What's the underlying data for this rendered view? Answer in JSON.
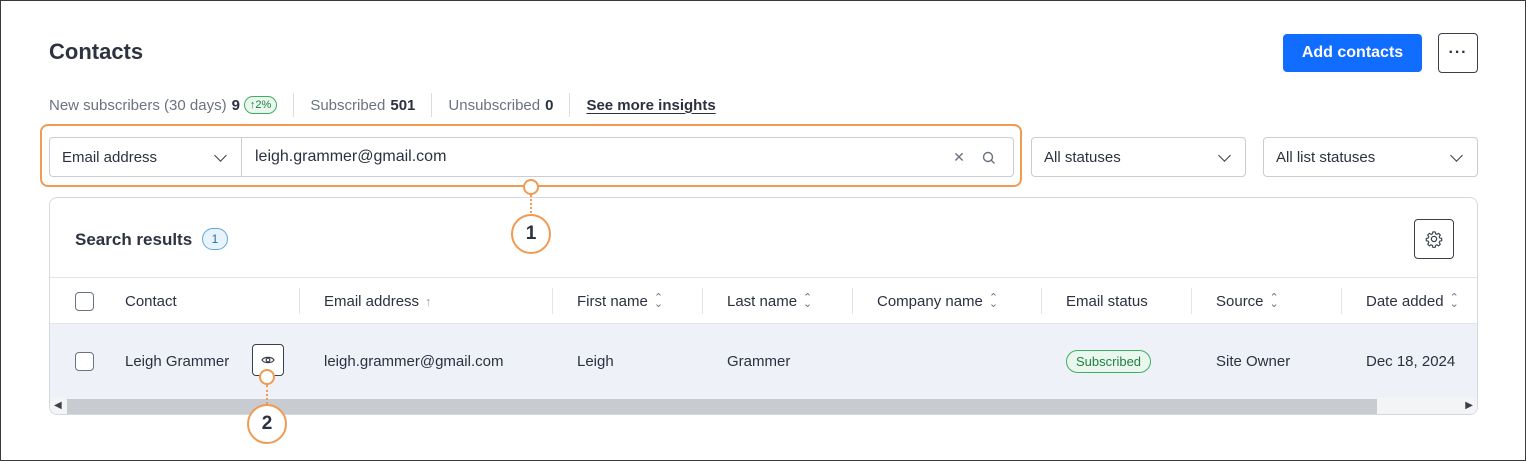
{
  "header": {
    "title": "Contacts",
    "add_button": "Add contacts",
    "more_button": "···"
  },
  "stats": {
    "new_subscribers_label": "New subscribers (30 days)",
    "new_subscribers_value": "9",
    "new_subscribers_trend": "↑2%",
    "subscribed_label": "Subscribed",
    "subscribed_value": "501",
    "unsubscribed_label": "Unsubscribed",
    "unsubscribed_value": "0",
    "insights_link": "See more insights"
  },
  "filters": {
    "search_type": "Email address",
    "search_value": "leigh.grammer@gmail.com",
    "status_select": "All statuses",
    "list_status_select": "All list statuses"
  },
  "results": {
    "title": "Search results",
    "count": "1"
  },
  "table": {
    "columns": [
      "Contact",
      "Email address",
      "First name",
      "Last name",
      "Company name",
      "Email status",
      "Source",
      "Date added"
    ],
    "rows": [
      {
        "contact": "Leigh Grammer",
        "email": "leigh.grammer@gmail.com",
        "first_name": "Leigh",
        "last_name": "Grammer",
        "company": "",
        "email_status": "Subscribed",
        "source": "Site Owner",
        "date_added": "Dec 18, 2024"
      }
    ]
  },
  "callouts": [
    "1",
    "2"
  ],
  "colors": {
    "primary": "#116dff",
    "callout": "#f09a53",
    "success": "#3fae62"
  }
}
